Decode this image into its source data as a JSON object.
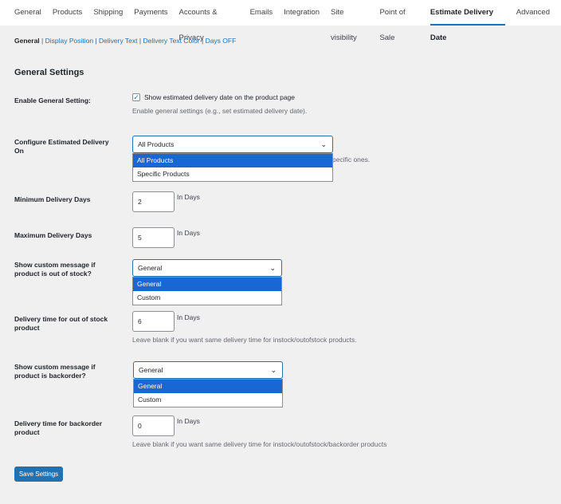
{
  "tabs": [
    "General",
    "Products",
    "Shipping",
    "Payments",
    "Accounts & Privacy",
    "Emails",
    "Integration",
    "Site visibility",
    "Point of Sale",
    "Estimate Delivery Date",
    "Advanced"
  ],
  "subnav": {
    "current": "General",
    "links": [
      "Display Position",
      "Delivery Text",
      "Delivery Text Color",
      "Days OFF"
    ]
  },
  "title": "General Settings",
  "enable": {
    "label": "Enable General Setting:",
    "checkbox_label": "Show estimated delivery date on the product page",
    "desc": "Enable general settings (e.g., set estimated delivery date)."
  },
  "configure": {
    "label": "Configure Estimated Delivery On",
    "value": "All Products",
    "options": [
      "All Products",
      "Specific Products"
    ],
    "desc_visible": "pecific ones."
  },
  "min_days": {
    "label": "Minimum Delivery Days",
    "value": "2",
    "unit": "In Days"
  },
  "max_days": {
    "label": "Maximum Delivery Days",
    "value": "5",
    "unit": "In Days"
  },
  "oos_msg": {
    "label": "Show custom message if product is out of stock?",
    "value": "General",
    "options": [
      "General",
      "Custom"
    ]
  },
  "oos_time": {
    "label": "Delivery time for out of stock product",
    "value": "6",
    "unit": "In Days",
    "desc": "Leave blank if you want same delivery time for instock/outofstock products."
  },
  "bo_msg": {
    "label": "Show custom message if product is backorder?",
    "value": "General",
    "options": [
      "General",
      "Custom"
    ]
  },
  "bo_time": {
    "label": "Delivery time for backorder product",
    "value": "0",
    "unit": "In Days",
    "desc": "Leave blank if you want same delivery time for instock/outofstock/backorder products"
  },
  "save": "Save Settings"
}
